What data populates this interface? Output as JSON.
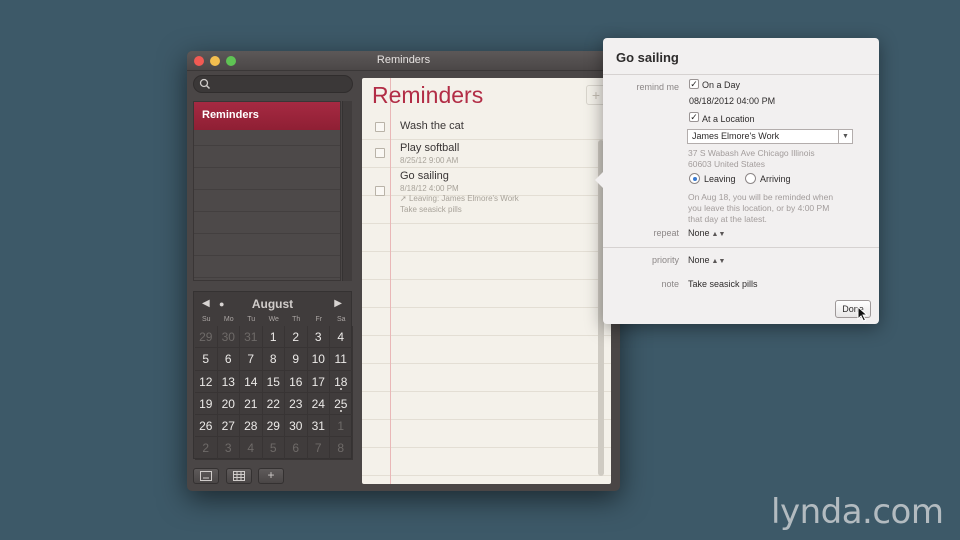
{
  "window": {
    "title": "Reminders"
  },
  "sidebar": {
    "search": {
      "placeholder": ""
    },
    "lists": [
      {
        "label": "Reminders",
        "selected": true
      }
    ]
  },
  "calendar": {
    "month": "August",
    "prev_icon": "triangle-left-icon",
    "today_icon": "dot-icon",
    "next_icon": "triangle-right-icon",
    "weekdays": [
      "Su",
      "Mo",
      "Tu",
      "We",
      "Th",
      "Fr",
      "Sa"
    ],
    "days": [
      {
        "n": "29",
        "dim": true
      },
      {
        "n": "30",
        "dim": true
      },
      {
        "n": "31",
        "dim": true
      },
      {
        "n": "1"
      },
      {
        "n": "2"
      },
      {
        "n": "3"
      },
      {
        "n": "4"
      },
      {
        "n": "5"
      },
      {
        "n": "6"
      },
      {
        "n": "7"
      },
      {
        "n": "8"
      },
      {
        "n": "9"
      },
      {
        "n": "10"
      },
      {
        "n": "11"
      },
      {
        "n": "12"
      },
      {
        "n": "13"
      },
      {
        "n": "14"
      },
      {
        "n": "15"
      },
      {
        "n": "16"
      },
      {
        "n": "17"
      },
      {
        "n": "18",
        "marked": true
      },
      {
        "n": "19"
      },
      {
        "n": "20"
      },
      {
        "n": "21"
      },
      {
        "n": "22"
      },
      {
        "n": "23"
      },
      {
        "n": "24"
      },
      {
        "n": "25",
        "marked": true
      },
      {
        "n": "26"
      },
      {
        "n": "27"
      },
      {
        "n": "28"
      },
      {
        "n": "29"
      },
      {
        "n": "30"
      },
      {
        "n": "31"
      },
      {
        "n": "1",
        "dim": true
      },
      {
        "n": "2",
        "dim": true
      },
      {
        "n": "3",
        "dim": true
      },
      {
        "n": "4",
        "dim": true
      },
      {
        "n": "5",
        "dim": true
      },
      {
        "n": "6",
        "dim": true
      },
      {
        "n": "7",
        "dim": true
      },
      {
        "n": "8",
        "dim": true
      }
    ]
  },
  "toolbar": {
    "add_label": "+"
  },
  "main": {
    "title": "Reminders",
    "add_label": "+",
    "reminders": [
      {
        "title": "Wash the cat",
        "lines": []
      },
      {
        "title": "Play softball",
        "lines": [
          "8/25/12 9:00 AM"
        ]
      },
      {
        "title": "Go sailing",
        "lines": [
          "8/18/12 4:00 PM",
          "Leaving: James Elmore's Work",
          "Take seasick pills"
        ]
      }
    ]
  },
  "popover": {
    "title": "Go sailing",
    "remind_me_label": "remind me",
    "on_a_day_label": "On a Day",
    "date_value": "08/18/2012  04:00 PM",
    "at_location_label": "At a Location",
    "location_value": "James Elmore's Work",
    "address_line1": "37 S Wabash Ave Chicago Illinois",
    "address_line2": "60603 United States",
    "leaving_label": "Leaving",
    "arriving_label": "Arriving",
    "info_line1": "On Aug 18, you will be reminded when",
    "info_line2": "you leave this location, or by 4:00 PM",
    "info_line3": "that day at the latest.",
    "repeat_label": "repeat",
    "repeat_value": "None",
    "priority_label": "priority",
    "priority_value": "None",
    "note_label": "note",
    "note_value": "Take seasick pills",
    "done_label": "Done"
  },
  "watermark": {
    "text": "lynda.com"
  }
}
